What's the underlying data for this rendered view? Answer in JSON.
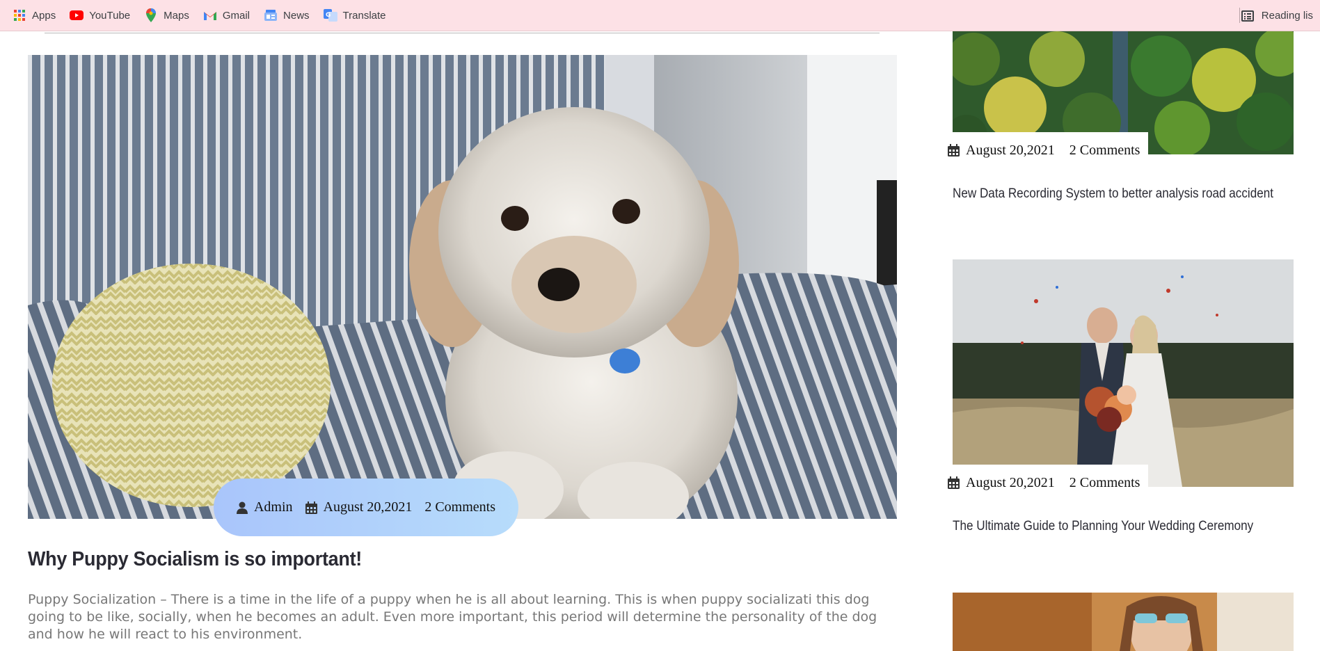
{
  "bookmarks": [
    {
      "label": "Apps",
      "icon": "apps-grid-icon"
    },
    {
      "label": "YouTube",
      "icon": "youtube-icon"
    },
    {
      "label": "Maps",
      "icon": "maps-pin-icon"
    },
    {
      "label": "Gmail",
      "icon": "gmail-icon"
    },
    {
      "label": "News",
      "icon": "news-icon"
    },
    {
      "label": "Translate",
      "icon": "translate-icon"
    }
  ],
  "reading_list": {
    "label": "Reading lis",
    "icon": "reading-list-icon"
  },
  "main_post": {
    "author": "Admin",
    "date": "August 20,2021",
    "comments": "2 Comments",
    "title": "Why Puppy Socialism is so important!",
    "excerpt": "Puppy Socialization – There is a time in the life of a puppy when he is all about learning. This is when puppy socializati this dog going to be like, socially, when he becomes an adult. Even more important, this period will determine the personality of the dog and how he will react to his environment."
  },
  "sidebar_posts": [
    {
      "date": "August 20,2021",
      "comments": "2 Comments",
      "title": "New Data Recording System to better analysis road accident"
    },
    {
      "date": "August 20,2021",
      "comments": "2 Comments",
      "title": "The Ultimate Guide to Planning Your Wedding Ceremony"
    }
  ],
  "colors": {
    "bookmarks_bg": "#fde1e6",
    "pill_start": "#a9c5fb",
    "pill_end": "#b7dcfb",
    "excerpt": "#777777"
  }
}
